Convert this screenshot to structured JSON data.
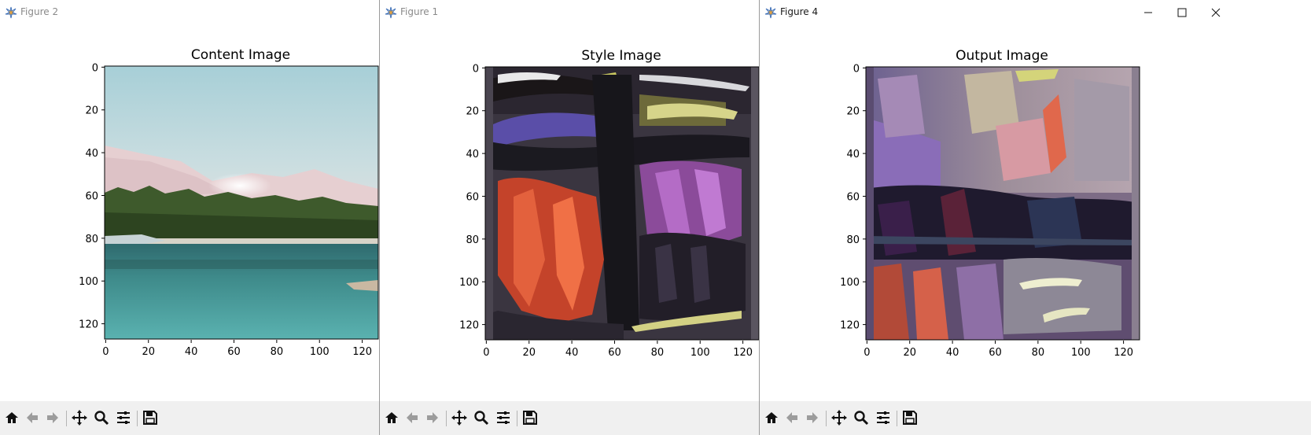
{
  "windows": [
    {
      "id": "fig2",
      "title": "Figure 2",
      "active": false,
      "plot_title": "Content Image",
      "image": "content"
    },
    {
      "id": "fig1",
      "title": "Figure 1",
      "active": false,
      "plot_title": "Style Image",
      "image": "style"
    },
    {
      "id": "fig4",
      "title": "Figure 4",
      "active": true,
      "plot_title": "Output Image",
      "image": "output"
    }
  ],
  "axes": {
    "x_ticks": [
      "0",
      "20",
      "40",
      "60",
      "80",
      "100",
      "120"
    ],
    "y_ticks": [
      "0",
      "20",
      "40",
      "60",
      "80",
      "100",
      "120"
    ],
    "range": [
      0,
      128
    ]
  },
  "toolbar": {
    "buttons": [
      "home-icon",
      "back-arrow-icon",
      "forward-arrow-icon",
      "pan-move-icon",
      "zoom-magnifier-icon",
      "configure-subplots-icon",
      "save-disk-icon"
    ]
  },
  "colors": {
    "toolbar_bg": "#f0f0f0",
    "title_inactive": "#8a8a8a",
    "title_active": "#1a1a1a"
  }
}
